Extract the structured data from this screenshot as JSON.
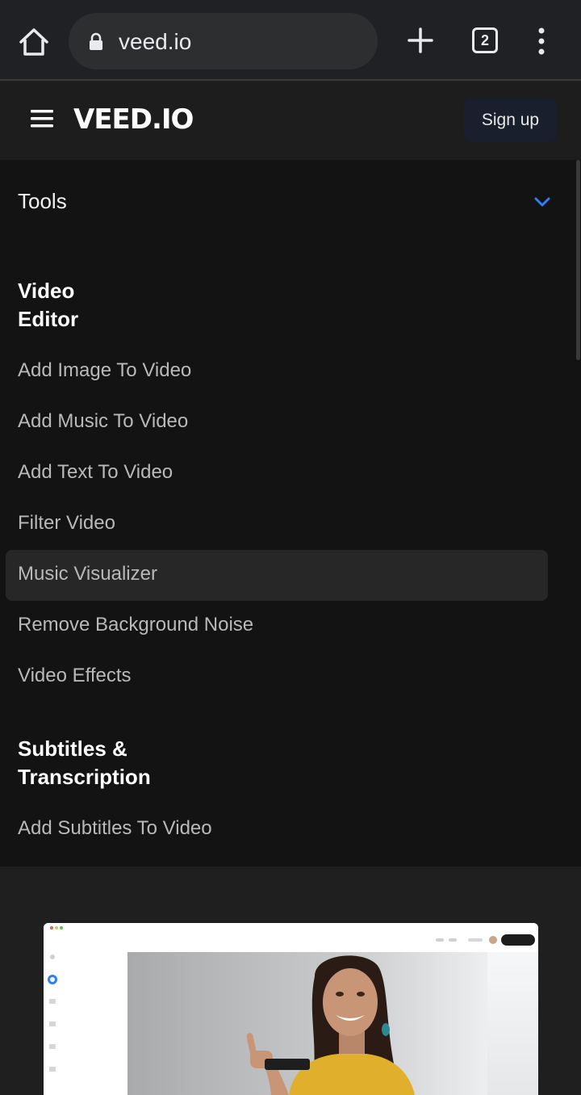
{
  "browser": {
    "url": "veed.io",
    "tab_count": "2"
  },
  "header": {
    "logo": "VEED.IO",
    "signup_label": "Sign up"
  },
  "menu": {
    "tools_label": "Tools",
    "sections": [
      {
        "title_line1": "Video",
        "title_line2": "Editor",
        "items": [
          "Add Image To Video",
          "Add Music To Video",
          "Add Text To Video",
          "Filter Video",
          "Music Visualizer",
          "Remove Background Noise",
          "Video Effects"
        ]
      },
      {
        "title_line1": "Subtitles &",
        "title_line2": "Transcription",
        "items": [
          "Add Subtitles To Video"
        ]
      }
    ]
  },
  "colors": {
    "accent": "#2d7ff9",
    "panel_bg": "#131313",
    "highlight_bg": "#272727"
  }
}
